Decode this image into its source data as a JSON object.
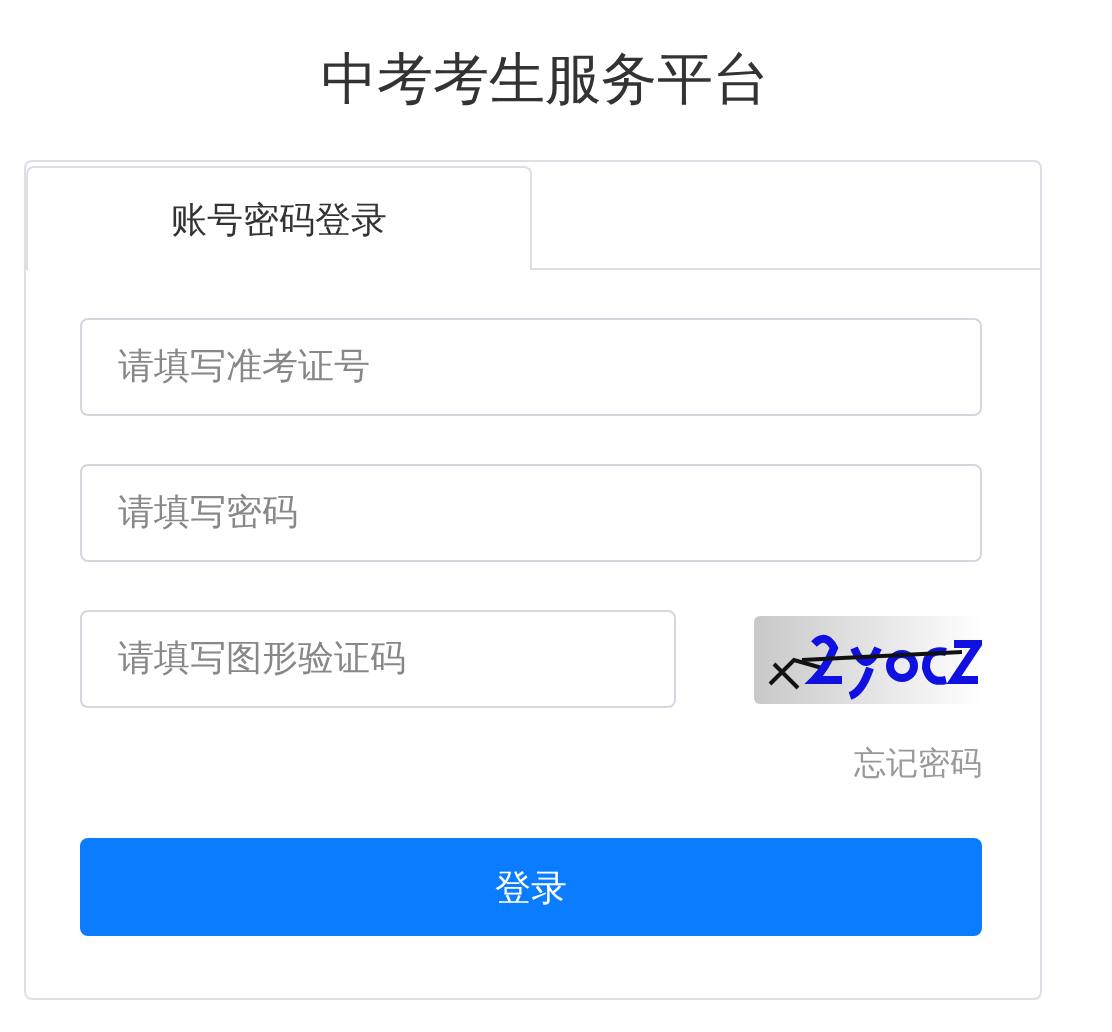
{
  "title": "中考考生服务平台",
  "tabs": [
    {
      "label": "账号密码登录",
      "selected": true
    }
  ],
  "fields": [
    {
      "placeholder": "请填写准考证号"
    },
    {
      "placeholder": "请填写密码"
    },
    {
      "placeholder": "请填写图形验证码"
    }
  ],
  "forgot_link": "忘记密码",
  "login_button": "登录"
}
